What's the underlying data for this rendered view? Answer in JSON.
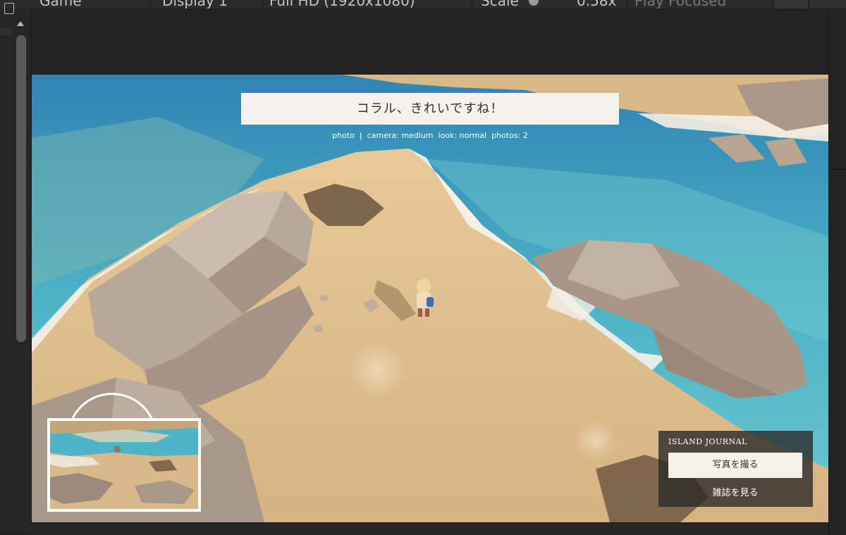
{
  "toolbar": {
    "game_tab": "Game",
    "display": "Display 1",
    "resolution": "Full HD (1920x1080)",
    "scale_label": "Scale",
    "scale_value": "0.58x",
    "play_focused": "Play Focused"
  },
  "game": {
    "speech": "コラル、きれいですね！",
    "debug": {
      "photo": "photo",
      "camera": "camera: medium",
      "look": "look: normal",
      "photos": "photos: 2"
    },
    "journal": {
      "title": "ISLAND JOURNAL",
      "photo_button": "写真を撮る",
      "view_button": "雑誌を見る"
    }
  },
  "colors": {
    "sea": "#48a9c2",
    "sand": "#d9b989",
    "rock": "#b9a797",
    "editor_bg": "#222222"
  }
}
